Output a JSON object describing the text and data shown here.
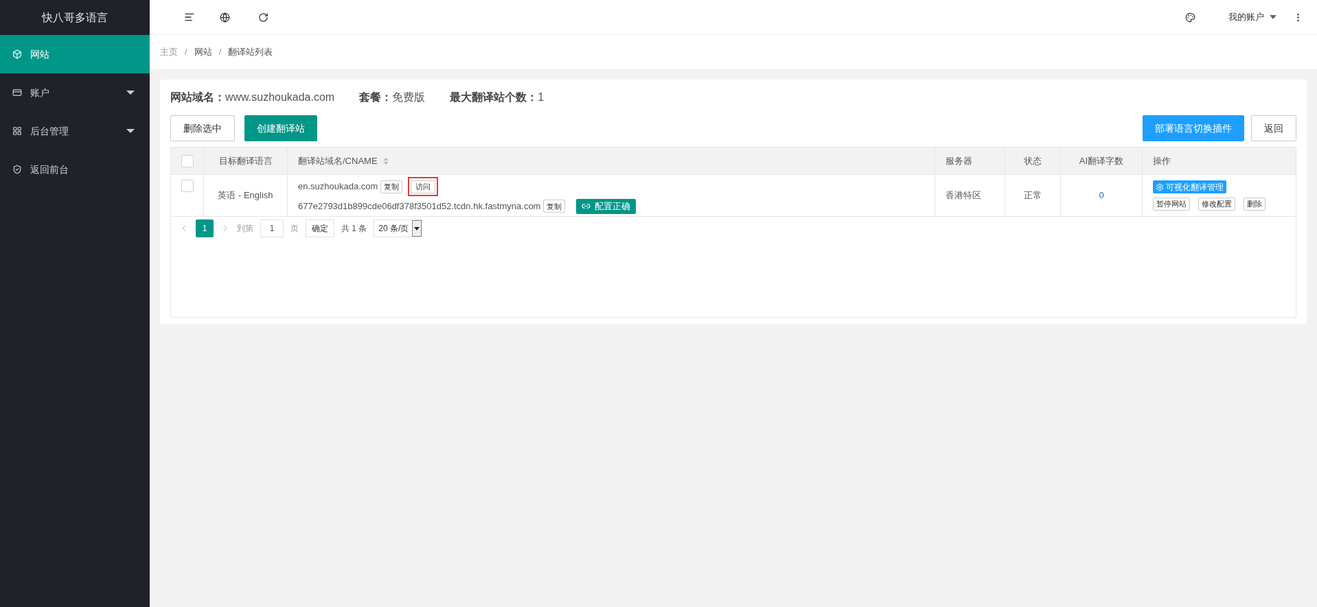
{
  "sidebar": {
    "title": "快八哥多语言",
    "items": [
      {
        "label": "网站",
        "selected": true,
        "has_submenu": false
      },
      {
        "label": "账户",
        "selected": false,
        "has_submenu": true
      },
      {
        "label": "后台管理",
        "selected": false,
        "has_submenu": true
      },
      {
        "label": "返回前台",
        "selected": false,
        "has_submenu": false
      }
    ]
  },
  "header": {
    "account": "我的账户"
  },
  "breadcrumb": {
    "separator": "/",
    "items": [
      "主页",
      "网站",
      "翻译站列表"
    ]
  },
  "info": [
    {
      "label": "网站域名：",
      "value": "www.suzhoukada.com"
    },
    {
      "label": "套餐：",
      "value": "免费版"
    },
    {
      "label": "最大翻译站个数：",
      "value": "1"
    }
  ],
  "actions_left": [
    {
      "label": "删除选中",
      "kind": "outline"
    },
    {
      "label": "创建翻译站",
      "kind": "primary"
    }
  ],
  "actions_right": [
    {
      "label": "部署语言切换插件",
      "kind": "blue"
    },
    {
      "label": "返回",
      "kind": "outline"
    }
  ],
  "table": {
    "select_all_checked": false,
    "columns": [
      "目标翻译语言",
      "翻译站域名/CNAME",
      "服务器",
      "状态",
      "AI翻译字数",
      "操作"
    ],
    "rows": [
      {
        "checked": false,
        "language": "英语 - English",
        "domain": "en.suzhoukada.com",
        "copy": "复制",
        "visit": "访问",
        "visit_highlighted": true,
        "cname": "677e2793d1b899cde06df378f3501d52.tcdn.hk.fastmyna.com",
        "cname_copy": "复制",
        "config_status": "配置正确",
        "server": "香港特区",
        "status": "正常",
        "ai_chars": "0",
        "manage": "可视化翻译管理",
        "ops": [
          "暂停网站",
          "修改配置",
          "删除"
        ]
      }
    ]
  },
  "pagination": {
    "pages": [
      {
        "label": "1",
        "selected": true
      }
    ],
    "goto_label": "到第",
    "goto_value": "1",
    "page_unit": "页",
    "confirm": "确定",
    "total": "共 1 条",
    "page_size": "20 条/页"
  }
}
